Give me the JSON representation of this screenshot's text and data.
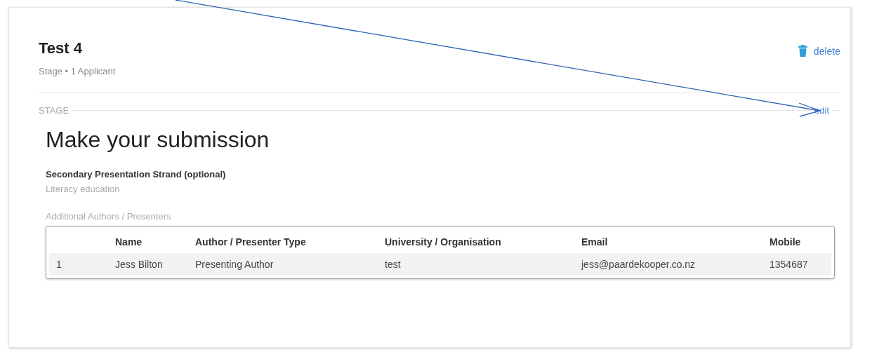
{
  "header": {
    "title": "Test 4",
    "subtitle": "Stage • 1 Applicant",
    "delete_link": "delete"
  },
  "stage": {
    "label": "STAGE",
    "edit_link": "edit"
  },
  "form": {
    "heading": "Make your submission",
    "fields": [
      {
        "label": "Secondary Presentation Strand (optional)",
        "value": "Literacy education"
      }
    ],
    "authors": {
      "label": "Additional Authors / Presenters",
      "columns": [
        "",
        "Name",
        "Author / Presenter Type",
        "University / Organisation",
        "Email",
        "Mobile"
      ],
      "rows": [
        [
          "1",
          "Jess Bilton",
          "Presenting Author",
          "test",
          "jess@paardekooper.co.nz",
          "1354687"
        ]
      ]
    }
  }
}
